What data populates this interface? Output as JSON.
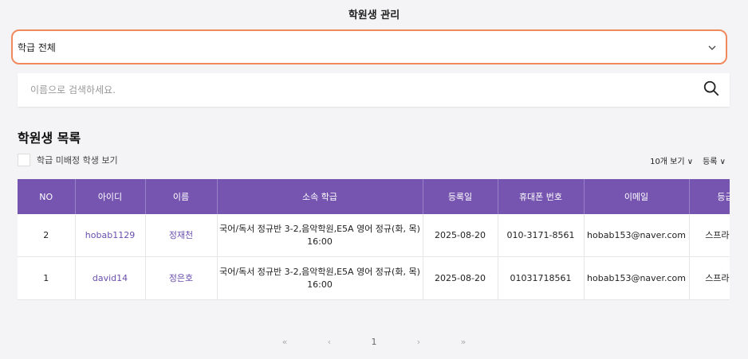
{
  "header": {
    "title": "학원생 관리"
  },
  "class_filter": {
    "selected": "학급 전체",
    "chevron": "chevron-down-icon"
  },
  "search": {
    "placeholder": "이름으로 검색하세요.",
    "value": "",
    "icon": "search-icon"
  },
  "list": {
    "title": "학원생 목록",
    "unassigned_label": "학급 미배정 학생 보기",
    "page_size_label": "10개 보기 ∨",
    "sort_label": "등록 ∨"
  },
  "table": {
    "columns": [
      "NO",
      "아이디",
      "이름",
      "소속 학급",
      "등록일",
      "휴대폰 번호",
      "이메일",
      "등급"
    ],
    "rows": [
      {
        "no": "2",
        "id": "hobab1129",
        "name": "정재천",
        "class": "국어/독서 정규반 3-2,음악학원,E5A 영어 정규(화, 목) 16:00",
        "registered": "2025-08-20",
        "phone": "010-3171-8561",
        "email": "hobab153@naver.com",
        "grade": "스프라우트"
      },
      {
        "no": "1",
        "id": "david14",
        "name": "정은호",
        "class": "국어/독서 정규반 3-2,음악학원,E5A 영어 정규(화, 목) 16:00",
        "registered": "2025-08-20",
        "phone": "01031718561",
        "email": "hobab153@naver.com",
        "grade": "스프라우트"
      }
    ]
  },
  "pagination": {
    "first": "«",
    "prev": "‹",
    "current": "1",
    "next": "›",
    "last": "»"
  },
  "colors": {
    "accent": "#7655b0",
    "select_border": "#f08a5d",
    "link": "#6a4fae"
  }
}
